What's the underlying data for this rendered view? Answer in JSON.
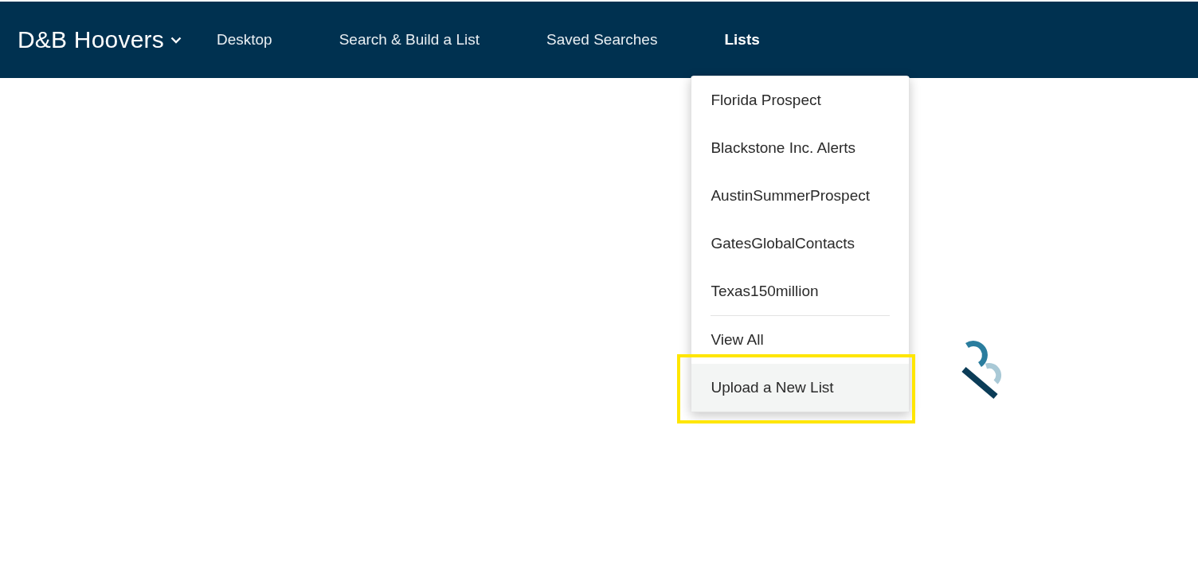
{
  "brand": {
    "name": "D&B Hoovers"
  },
  "nav": [
    {
      "label": "Desktop",
      "open": false
    },
    {
      "label": "Search & Build a List",
      "open": false
    },
    {
      "label": "Saved Searches",
      "open": false
    },
    {
      "label": "Lists",
      "open": true
    }
  ],
  "lists_menu": {
    "lists": [
      {
        "label": "Florida Prospect",
        "highlighted": false
      },
      {
        "label": "Blackstone Inc. Alerts",
        "highlighted": false
      },
      {
        "label": "AustinSummerProspect",
        "highlighted": false
      },
      {
        "label": "GatesGlobalContacts",
        "highlighted": false
      },
      {
        "label": "Texas150million",
        "highlighted": false
      }
    ],
    "actions": [
      {
        "label": "View All",
        "highlighted": false
      },
      {
        "label": "Upload a New List",
        "highlighted": true,
        "callout": true
      }
    ]
  }
}
